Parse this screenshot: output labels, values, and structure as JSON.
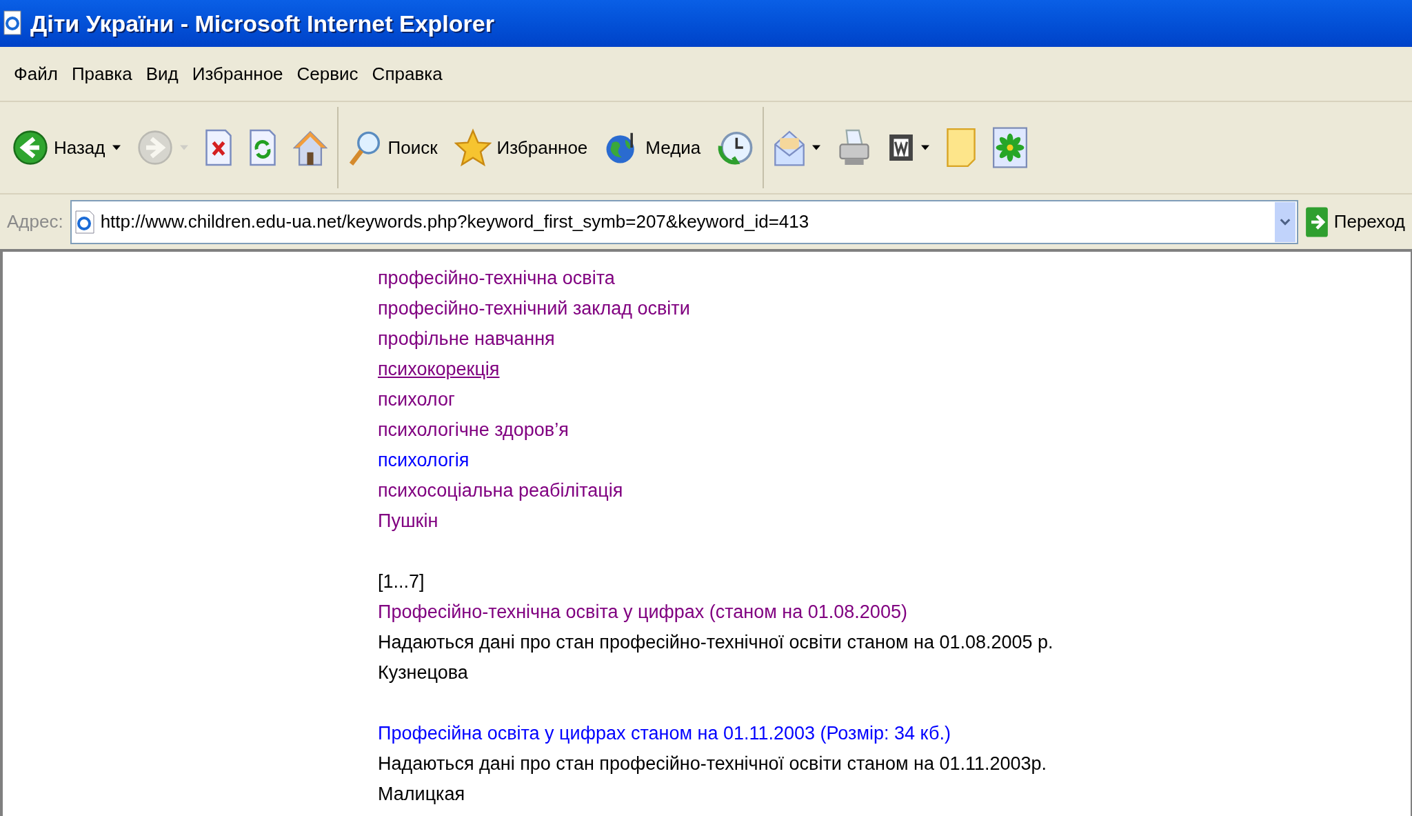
{
  "window": {
    "title": "Діти України - Microsoft Internet Explorer"
  },
  "menu": [
    "Файл",
    "Правка",
    "Вид",
    "Избранное",
    "Сервис",
    "Справка"
  ],
  "toolbar": {
    "groups": [
      [
        {
          "label": "Назад",
          "dropdown": true,
          "disabled": false
        },
        {
          "dropdown": true,
          "disabled": true
        },
        {
          "dropdown": false,
          "disabled": false
        },
        {
          "dropdown": false,
          "disabled": false
        },
        {
          "dropdown": false,
          "disabled": false
        }
      ],
      [
        {
          "label": "Поиск",
          "dropdown": false,
          "disabled": false
        },
        {
          "label": "Избранное",
          "dropdown": false,
          "disabled": false
        },
        {
          "label": "Медиа",
          "dropdown": false,
          "disabled": false
        },
        {
          "dropdown": false,
          "disabled": false
        }
      ],
      [
        {
          "dropdown": true,
          "disabled": false
        },
        {
          "dropdown": false,
          "disabled": false
        },
        {
          "dropdown": true,
          "disabled": false
        },
        {
          "dropdown": false,
          "disabled": false
        },
        {
          "dropdown": false,
          "disabled": false
        }
      ]
    ]
  },
  "address": {
    "label": "Адрес:",
    "value": "http://www.children.edu-ua.net/keywords.php?keyword_first_symb=207&keyword_id=413",
    "go": "Переход"
  },
  "keywords": [
    {
      "text": "професійно-технічна освіта",
      "visited": true,
      "hovered": false
    },
    {
      "text": "професійно-технічний заклад освіти",
      "visited": true,
      "hovered": false
    },
    {
      "text": "профільне навчання",
      "visited": true,
      "hovered": false
    },
    {
      "text": "психокорекція",
      "visited": true,
      "hovered": true
    },
    {
      "text": "психолог",
      "visited": true,
      "hovered": false
    },
    {
      "text": "психологічне здоров’я",
      "visited": true,
      "hovered": false
    },
    {
      "text": "психологія",
      "visited": false,
      "hovered": false
    },
    {
      "text": "психосоціальна реабілітація",
      "visited": true,
      "hovered": false
    },
    {
      "text": "Пушкін",
      "visited": true,
      "hovered": false
    }
  ],
  "pager": "[1...7]",
  "results": [
    {
      "title": "Професійно-технічна освіта у цифрах (станом на 01.08.2005)",
      "visited": true,
      "description": "Надаються дані про стан професійно-технічної освіти станом на 01.08.2005 р.",
      "author": "Кузнецова"
    },
    {
      "title": "Професійна освіта у цифрах станом на 01.11.2003 (Розмір: 34 кб.)",
      "visited": false,
      "description": "Надаються дані про стан професійно-технічної освіти станом на 01.11.2003р.",
      "author": "Малицкая"
    }
  ]
}
